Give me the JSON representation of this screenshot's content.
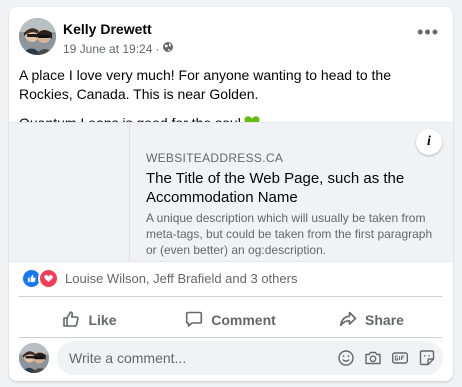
{
  "post": {
    "author": "Kelly Drewett",
    "timestamp": "19 June at 19:24",
    "separator": "·",
    "audience_icon": "globe-icon",
    "more_icon": "more-options-icon",
    "more_label": "•••",
    "text_line1": "A place I love very much! For anyone wanting to head to the Rockies, Canada. This is near Golden.",
    "text_line2": "Quantum Leaps is good for the soul",
    "text_emoji": "green-heart-icon"
  },
  "link_preview": {
    "domain": "WEBSITEADDRESS.CA",
    "title": "The Title of the Web Page, such as the Accommodation Name",
    "description": "A unique description which will usually be taken from meta-tags, but could be taken from the first paragraph or (even better) an og:description.",
    "info_label": "i"
  },
  "reactions": {
    "types": [
      "like",
      "love"
    ],
    "names": "Louise Wilson, Jeff Brafield and 3 others"
  },
  "actions": {
    "like": "Like",
    "comment": "Comment",
    "share": "Share"
  },
  "comment_box": {
    "placeholder": "Write a comment...",
    "icons": [
      "emoji-icon",
      "camera-icon",
      "gif-icon",
      "sticker-icon"
    ]
  },
  "colors": {
    "page_bg": "#f0f2f5",
    "card_bg": "#ffffff",
    "secondary_text": "#65676b",
    "like_blue": "#1877f2",
    "love_red": "#f33e58",
    "heart_green": "#63be09"
  }
}
